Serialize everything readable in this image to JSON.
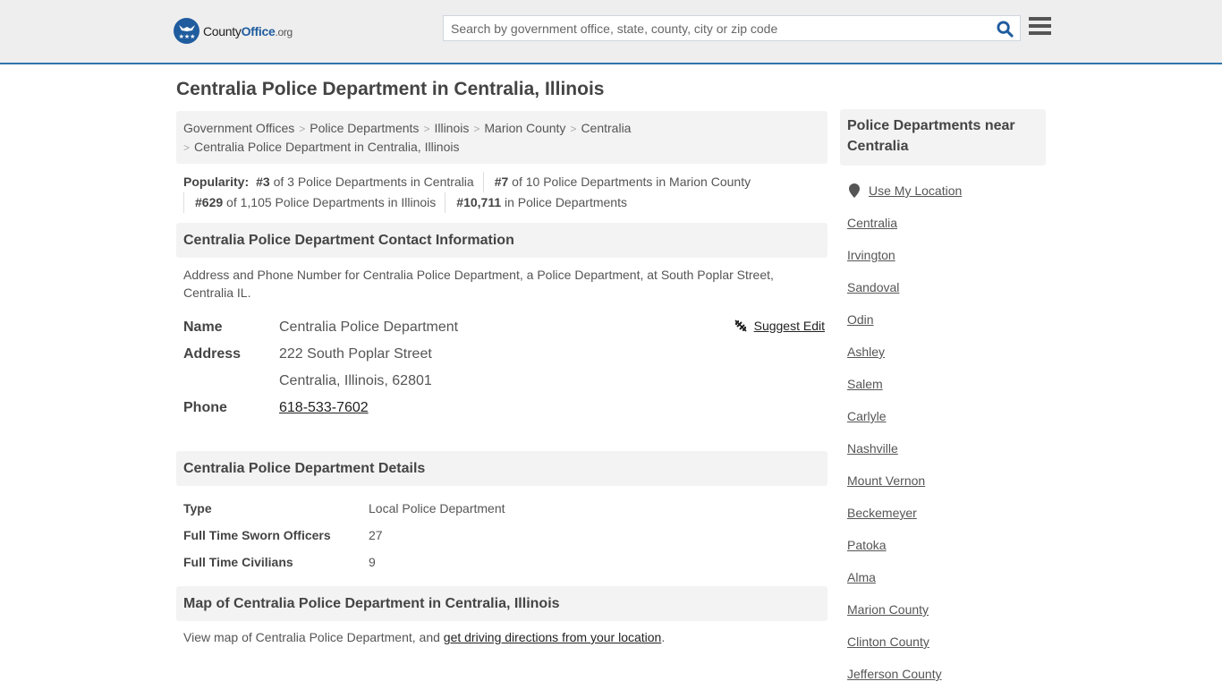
{
  "header": {
    "logo": {
      "brand_county": "County",
      "brand_office": "Office",
      "brand_tld": ".org"
    },
    "search": {
      "placeholder": "Search by government office, state, county, city or zip code",
      "value": ""
    },
    "icons": {
      "search": "search-icon",
      "menu": "hamburger-menu-icon"
    }
  },
  "page": {
    "title": "Centralia Police Department in Centralia, Illinois"
  },
  "breadcrumb": [
    "Government Offices",
    "Police Departments",
    "Illinois",
    "Marion County",
    "Centralia",
    "Centralia Police Department in Centralia, Illinois"
  ],
  "popularity": {
    "label": "Popularity:",
    "items": [
      {
        "rank": "#3",
        "text": " of 3 Police Departments in Centralia"
      },
      {
        "rank": "#7",
        "text": " of 10 Police Departments in Marion County"
      },
      {
        "rank": "#629",
        "text": " of 1,105 Police Departments in Illinois"
      },
      {
        "rank": "#10,711",
        "text": " in Police Departments"
      }
    ]
  },
  "contact": {
    "heading": "Centralia Police Department Contact Information",
    "description": "Address and Phone Number for Centralia Police Department, a Police Department, at South Poplar Street, Centralia IL.",
    "suggest_edit": "Suggest Edit",
    "name_label": "Name",
    "name_value": "Centralia Police Department",
    "address_label": "Address",
    "address_line1": "222 South Poplar Street",
    "address_line2": "Centralia, Illinois, 62801",
    "phone_label": "Phone",
    "phone_value": "618-533-7602"
  },
  "details": {
    "heading": "Centralia Police Department Details",
    "rows": [
      {
        "label": "Type",
        "value": "Local Police Department"
      },
      {
        "label": "Full Time Sworn Officers",
        "value": "27"
      },
      {
        "label": "Full Time Civilians",
        "value": "9"
      }
    ]
  },
  "map": {
    "heading": "Map of Centralia Police Department in Centralia, Illinois",
    "text_before": "View map of Centralia Police Department, and ",
    "link_text": "get driving directions from your location",
    "text_after": "."
  },
  "sidebar": {
    "heading": "Police Departments near Centralia",
    "use_location": "Use My Location",
    "links": [
      "Centralia",
      "Irvington",
      "Sandoval",
      "Odin",
      "Ashley",
      "Salem",
      "Carlyle",
      "Nashville",
      "Mount Vernon",
      "Beckemeyer",
      "Patoka",
      "Alma",
      "Marion County",
      "Clinton County",
      "Jefferson County"
    ]
  },
  "colors": {
    "accent": "#2e75ad",
    "brand": "#1f5c9e",
    "header_bg": "#eeeeee",
    "panel_bg": "#f3f3f3"
  }
}
